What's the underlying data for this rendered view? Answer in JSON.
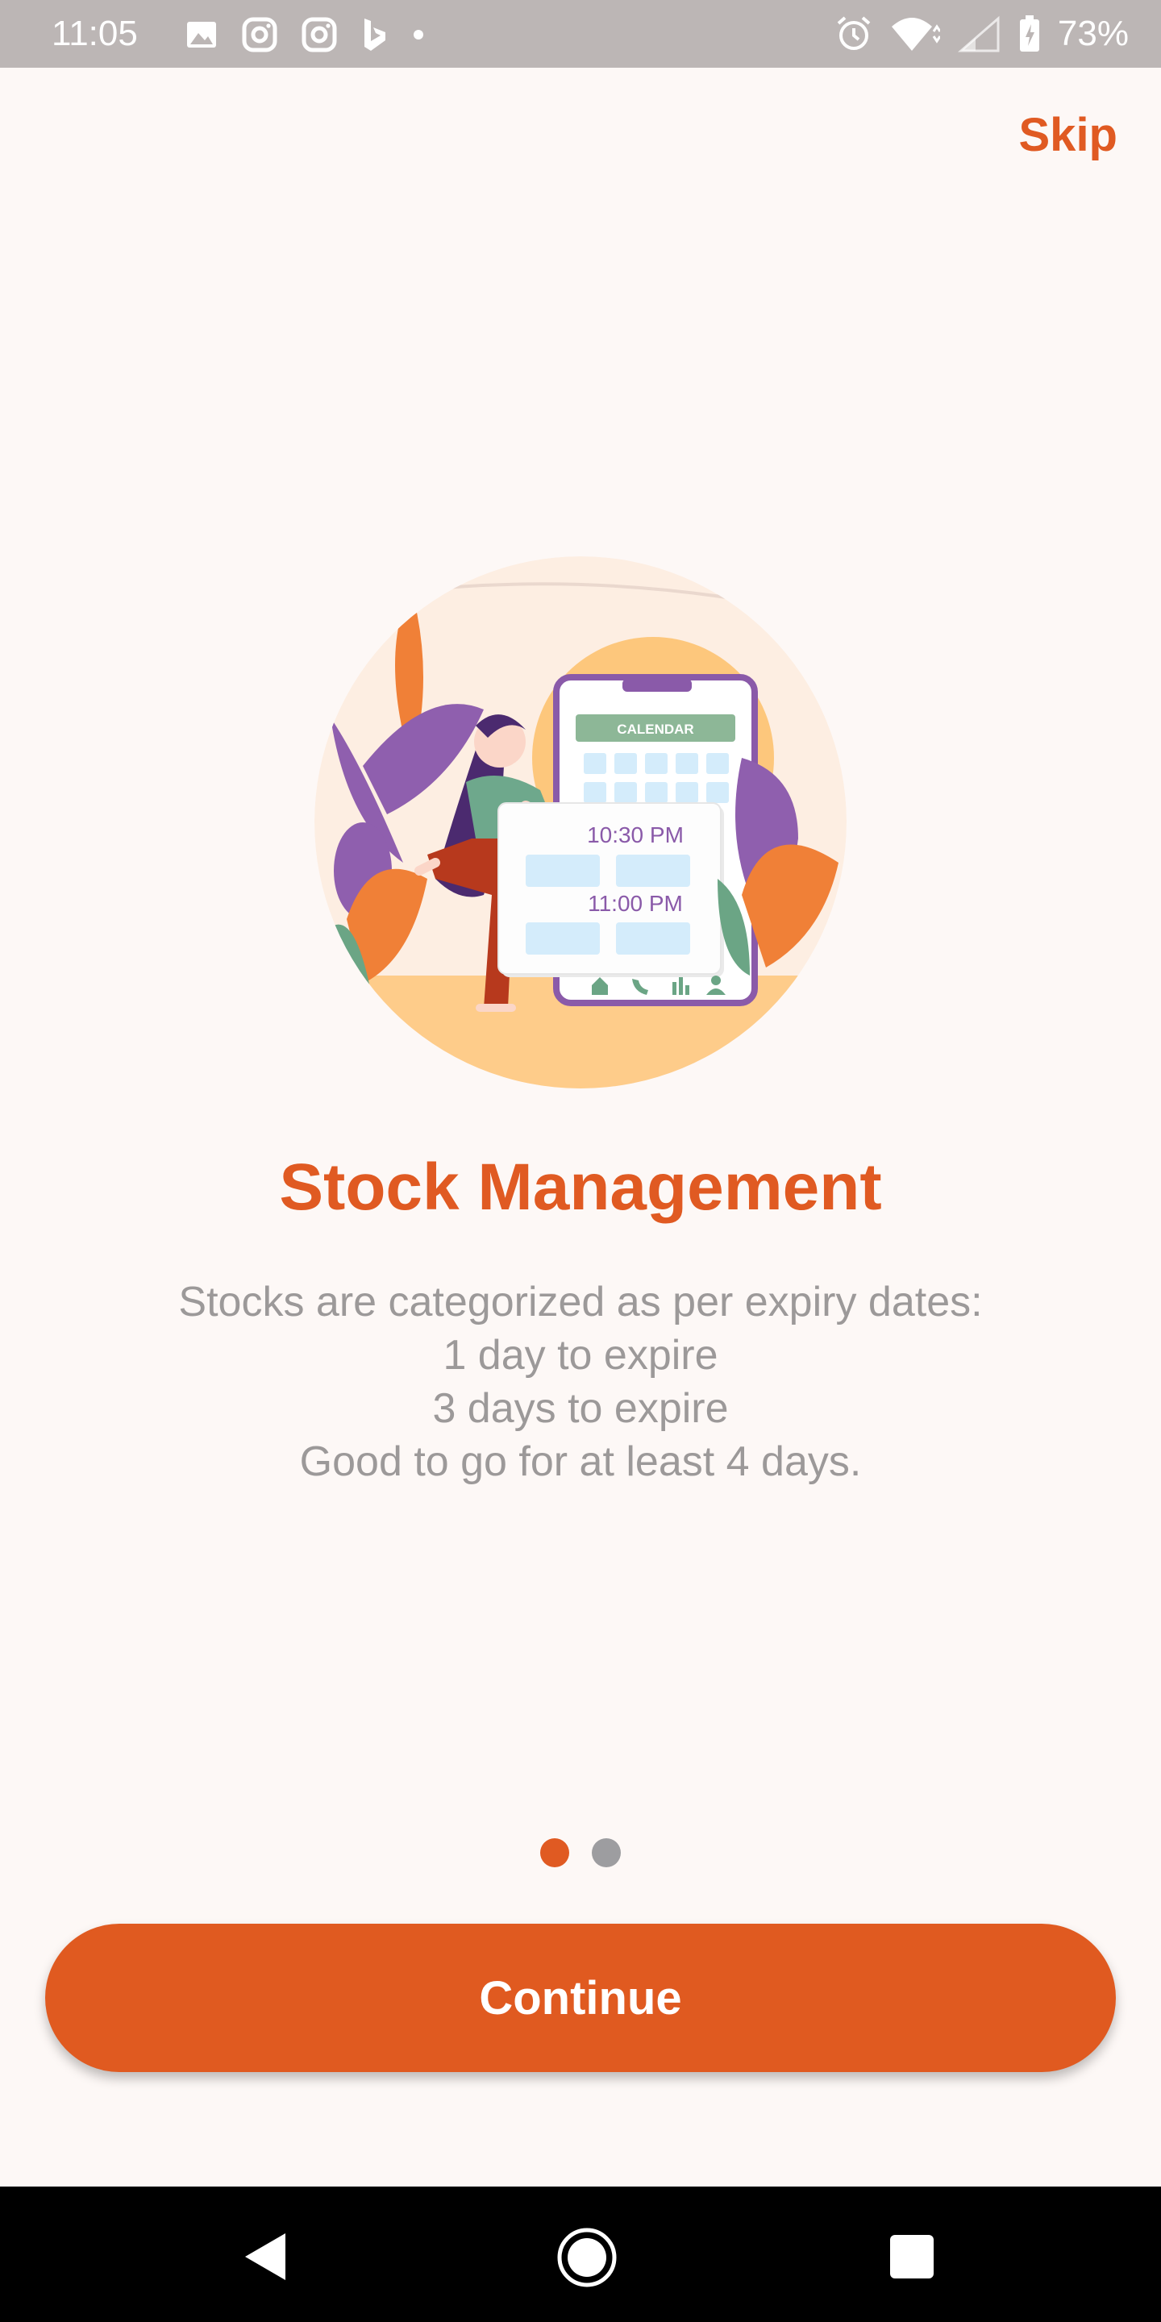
{
  "status_bar": {
    "time": "11:05",
    "battery": "73%",
    "left_icons": [
      "image-icon",
      "instagram-icon",
      "instagram-icon",
      "bing-icon",
      "dot-icon"
    ],
    "right_icons": [
      "alarm-icon",
      "wifi-icon",
      "signal-icon",
      "battery-icon"
    ]
  },
  "header": {
    "skip_label": "Skip"
  },
  "illustration": {
    "calendar_label": "CALENDAR",
    "time_1": "10:30 PM",
    "time_2": "11:00 PM"
  },
  "onboarding": {
    "title": "Stock Management",
    "description_lines": [
      "Stocks are categorized as per expiry dates:",
      "1 day to expire",
      "3 days to expire",
      "Good to go for at least 4 days."
    ],
    "page_count": 2,
    "active_page": 1
  },
  "footer": {
    "continue_label": "Continue"
  },
  "colors": {
    "accent": "#e05a22",
    "text_muted": "#9c9999",
    "background": "#fdf8f6"
  }
}
